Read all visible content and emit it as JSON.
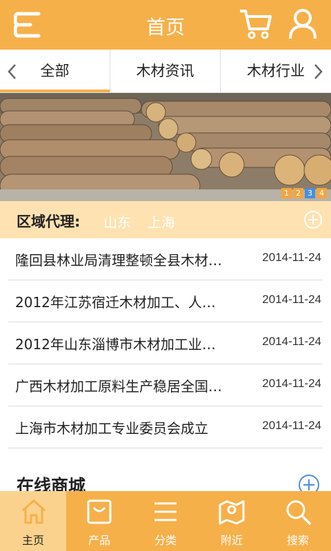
{
  "header": {
    "title": "首页",
    "menu_icon": "menu-icon",
    "cart_icon": "cart-icon",
    "user_icon": "user-icon"
  },
  "tabs": [
    {
      "label": "全部",
      "active": true
    },
    {
      "label": "木材资讯",
      "active": false
    },
    {
      "label": "木材行业",
      "active": false
    }
  ],
  "banner": {
    "slides": [
      "1",
      "2",
      "3",
      "4"
    ],
    "active_slide": "3"
  },
  "region": {
    "label": "区域代理:",
    "links": [
      "山东",
      "上海"
    ],
    "more_icon": "plus-circle-icon"
  },
  "news": [
    {
      "title": "隆回县林业局清理整顿全县木材…",
      "date": "2014-11-24"
    },
    {
      "title": "2012年江苏宿迁木材加工、人…",
      "date": "2014-11-24"
    },
    {
      "title": "2012年山东淄博市木材加工业…",
      "date": "2014-11-24"
    },
    {
      "title": "广西木材加工原料生产稳居全国…",
      "date": "2014-11-24"
    },
    {
      "title": "上海市木材加工专业委员会成立",
      "date": "2014-11-24"
    }
  ],
  "shop_section": {
    "title": "在线商城",
    "more_icon": "plus-circle-icon"
  },
  "bottom_nav": [
    {
      "label": "主页",
      "icon": "home-icon",
      "active": true
    },
    {
      "label": "产品",
      "icon": "bag-icon",
      "active": false
    },
    {
      "label": "分类",
      "icon": "list-icon",
      "active": false
    },
    {
      "label": "附近",
      "icon": "map-icon",
      "active": false
    },
    {
      "label": "搜索",
      "icon": "search-icon",
      "active": false
    }
  ],
  "colors": {
    "primary": "#f6b04a",
    "region_bg": "#ffe2b1",
    "active_dot": "#4a8fd8"
  }
}
